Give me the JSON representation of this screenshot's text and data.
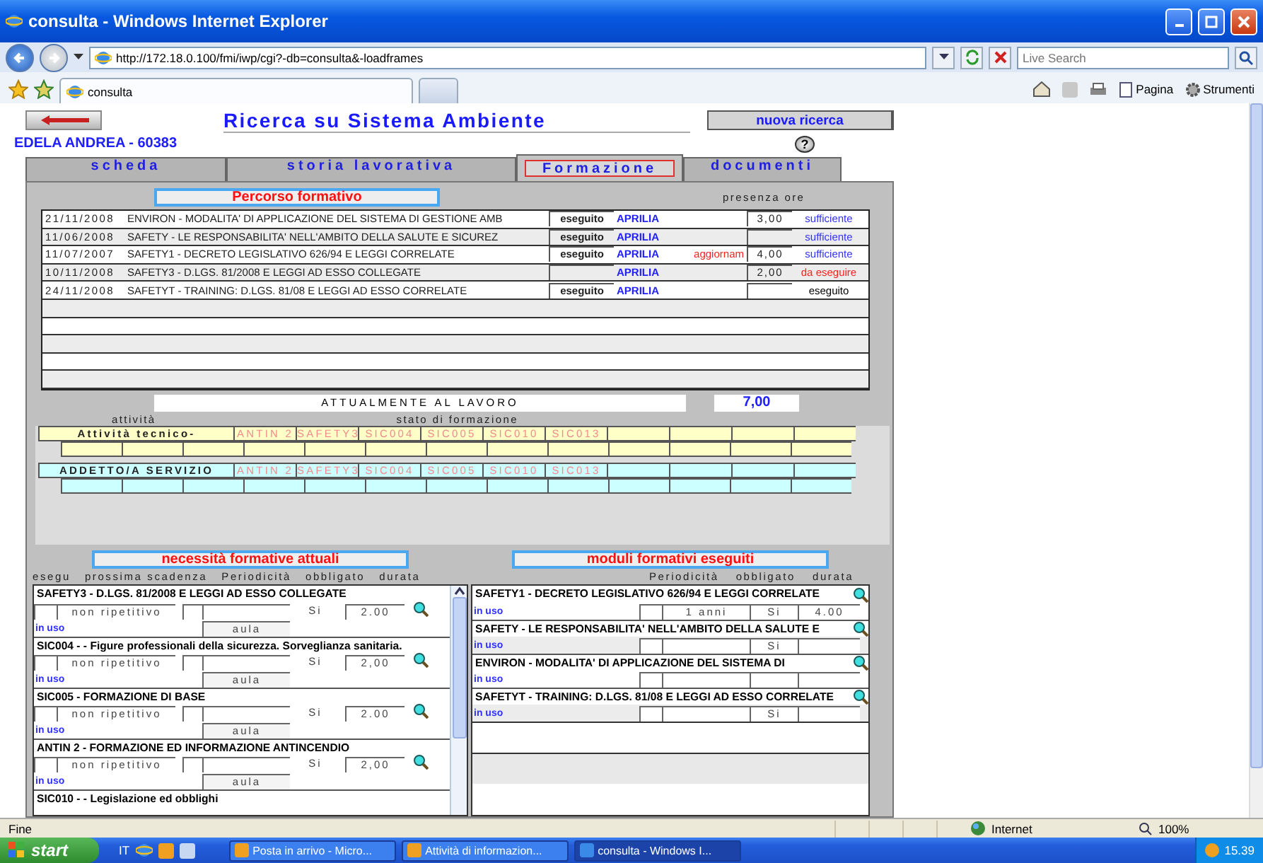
{
  "window": {
    "title": "consulta - Windows Internet Explorer"
  },
  "address_bar": {
    "url": "http://172.18.0.100/fmi/iwp/cgi?-db=consulta&-loadframes",
    "search_placeholder": "Live Search"
  },
  "browser_tabs": [
    {
      "label": "consulta",
      "selected": true
    }
  ],
  "command_bar": [
    "Pagina",
    "Strumenti"
  ],
  "page": {
    "title": "Ricerca su Sistema Ambiente",
    "new_search": "nuova ricerca",
    "person": "EDELA ANDREA - 60383",
    "help": "?",
    "tabs": [
      {
        "label": "scheda",
        "selected": false
      },
      {
        "label": "storia lavorativa",
        "selected": false
      },
      {
        "label": "Formazione",
        "selected": true
      },
      {
        "label": "documenti",
        "selected": false
      }
    ],
    "path": {
      "label": "Percorso formativo",
      "header": "presenza ore",
      "courses": [
        {
          "date": "21/11/2008",
          "title": "ENVIRON - MODALITA' DI APPLICAZIONE DEL SISTEMA DI GESTIONE AMB",
          "status": "eseguito",
          "place": "APRILIA",
          "hours": "3,00",
          "result": "sufficiente",
          "color": "#3333ff"
        },
        {
          "date": "11/06/2008",
          "title": "SAFETY - LE RESPONSABILITA' NELL'AMBITO DELLA SALUTE E SICUREZ",
          "status": "eseguito",
          "place": "APRILIA",
          "result": "sufficiente",
          "color": "#3333ff"
        },
        {
          "date": "11/07/2007",
          "title": "SAFETY1 - DECRETO LEGISLATIVO 626/94 E LEGGI CORRELATE",
          "status": "eseguito",
          "place": "APRILIA",
          "note": "aggiornam",
          "hours": "4,00",
          "result": "sufficiente",
          "color": "#3333ff"
        },
        {
          "date": "10/11/2008",
          "title": "SAFETY3 - D.LGS. 81/2008 E LEGGI AD ESSO COLLEGATE",
          "place": "APRILIA",
          "hours": "2,00",
          "result": "da eseguire",
          "color": "#ff2020"
        },
        {
          "date": "24/11/2008",
          "title": "SAFETYT - TRAINING: D.LGS. 81/08 E LEGGI AD ESSO CORRELATE",
          "status": "eseguito",
          "place": "APRILIA",
          "result": "eseguito",
          "color": "#000000"
        }
      ]
    },
    "current": {
      "label": "ATTUALMENTE AL LAVORO",
      "hours": "7,00"
    },
    "activity_header": "attività",
    "state_header": "stato di formazione",
    "activities": [
      {
        "name": "Attività tecnico-",
        "color": "#ffffc8",
        "modules": [
          "ANTIN 2",
          "SAFETY3",
          "SIC004",
          "SIC005",
          "SIC010",
          "SIC013"
        ]
      },
      {
        "name": "ADDETTO/A SERVIZIO",
        "color": "#ccffff",
        "modules": [
          "ANTIN 2",
          "SAFETY3",
          "SIC004",
          "SIC005",
          "SIC010",
          "SIC013"
        ]
      }
    ],
    "needs": {
      "label": "necessità formative attuali",
      "headers": [
        "esegu",
        "prossima scadenza",
        "Periodicità",
        "obbligato",
        "durata"
      ],
      "items": [
        {
          "title": "SAFETY3 - D.LGS. 81/2008 E LEGGI AD ESSO COLLEGATE",
          "periodicity": "non ripetitivo",
          "required": "Si",
          "duration": "2.00",
          "status": "in uso",
          "mode": "aula"
        },
        {
          "title": "SIC004 - - Figure professionali della sicurezza. Sorveglianza sanitaria.",
          "periodicity": "non ripetitivo",
          "required": "Si",
          "duration": "2,00",
          "status": "in uso",
          "mode": "aula"
        },
        {
          "title": "SIC005 - FORMAZIONE DI BASE",
          "periodicity": "non ripetitivo",
          "required": "Si",
          "duration": "2.00",
          "status": "in uso",
          "mode": "aula"
        },
        {
          "title": "ANTIN 2 - FORMAZIONE ED INFORMAZIONE ANTINCENDIO",
          "periodicity": "non ripetitivo",
          "required": "Si",
          "duration": "2,00",
          "status": "in uso",
          "mode": "aula"
        },
        {
          "title": "SIC010 - - Legislazione ed obblighi"
        }
      ]
    },
    "done": {
      "label": "moduli formativi eseguiti",
      "headers": [
        "Periodicità",
        "obbligato",
        "durata"
      ],
      "items": [
        {
          "title": "SAFETY1 - DECRETO LEGISLATIVO 626/94 E LEGGI CORRELATE",
          "status": "in uso",
          "periodicity": "1 anni",
          "required": "Si",
          "duration": "4.00"
        },
        {
          "title": "SAFETY - LE RESPONSABILITA' NELL'AMBITO DELLA SALUTE E",
          "status": "in uso",
          "required": "Si"
        },
        {
          "title": "ENVIRON - MODALITA' DI APPLICAZIONE DEL SISTEMA DI",
          "status": "in uso"
        },
        {
          "title": "SAFETYT - TRAINING: D.LGS. 81/08 E LEGGI AD ESSO CORRELATE",
          "status": "in uso",
          "required": "Si"
        }
      ]
    }
  },
  "status_bar": {
    "text": "Fine",
    "zone": "Internet",
    "zoom": "100%"
  },
  "taskbar": {
    "start": "start",
    "language": "IT",
    "tasks": [
      {
        "label": "Posta in arrivo - Micro...",
        "selected": false
      },
      {
        "label": "Attività di informazion...",
        "selected": false
      },
      {
        "label": "consulta - Windows I...",
        "selected": true
      }
    ],
    "clock": "15.39"
  }
}
